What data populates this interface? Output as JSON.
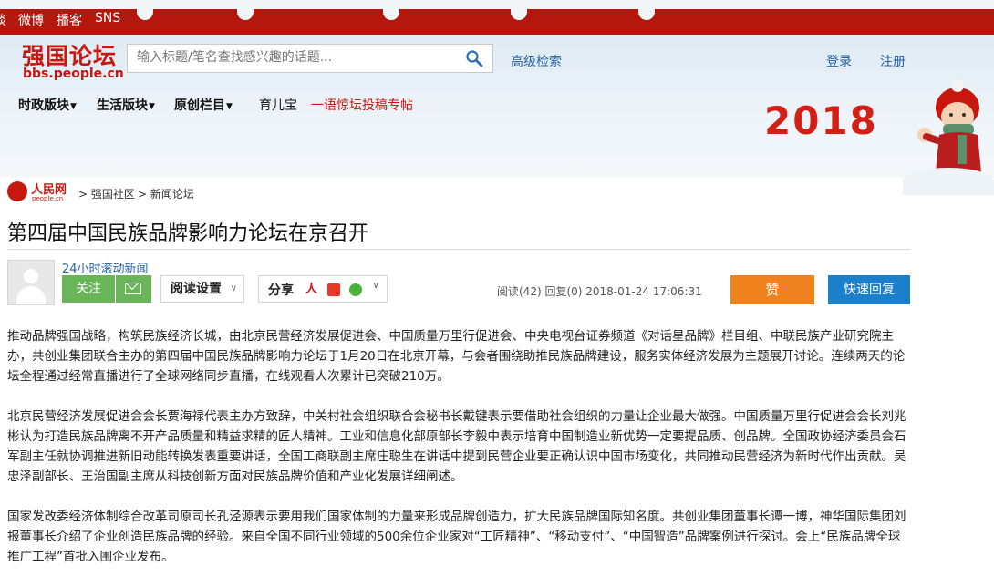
{
  "topbar": {
    "links": [
      "淡",
      "微博",
      "播客",
      "SNS"
    ]
  },
  "logo": {
    "main": "强国论坛",
    "sub": "bbs.people.cn"
  },
  "search": {
    "placeholder": "输入标题/笔名查找感兴趣的话题..."
  },
  "header": {
    "advanced_search": "高级检索",
    "login": "登录",
    "register": "注册",
    "nav": [
      "时政版块",
      "生活版块",
      "原创栏目",
      "育儿宝",
      "一语惊坛投稿专帖"
    ],
    "year": "2018"
  },
  "breadcrumb": {
    "logo_text": "人民网",
    "logo_url": "people.cn",
    "items": [
      "> 强国社区",
      "> 新闻论坛"
    ]
  },
  "article": {
    "title": "第四届中国民族品牌影响力论坛在京召开",
    "author": "24小时滚动新闻",
    "follow": "关注",
    "read_settings": "阅读设置",
    "share": "分享",
    "stats": "阅读(42) 回复(0)  2018-01-24 17:06:31",
    "like": "赞",
    "quick_reply": "快速回复",
    "paragraphs": [
      "推动品牌强国战略，构筑民族经济长城，由北京民营经济发展促进会、中国质量万里行促进会、中央电视台证券频道《对话星品牌》栏目组、中联民族产业研究院主办，共创业集团联合主办的第四届中国民族品牌影响力论坛于1月20日在北京开幕，与会者围绕助推民族品牌建设，服务实体经济发展为主题展开讨论。连续两天的论坛全程通过经常直播进行了全球网络同步直播，在线观看人次累计已突破210万。",
      "北京民营经济发展促进会会长贾海禄代表主办方致辞，中关村社会组织联合会秘书长戴键表示要借助社会组织的力量让企业最大做强。中国质量万里行促进会会长刘兆彬认为打造民族品牌离不开产品质量和精益求精的匠人精神。工业和信息化部原部长李毅中表示培育中国制造业新优势一定要提品质、创品牌。全国政协经济委员会石军副主任就协调推进新旧动能转换发表重要讲话，全国工商联副主席庄聪生在讲话中提到民营企业要正确认识中国市场变化，共同推动民营经济为新时代作出贡献。吴忠泽副部长、王治国副主席从科技创新方面对民族品牌价值和产业化发展详细阐述。",
      "国家发改委经济体制综合改革司原司长孔泾源表示要用我们国家体制的力量来形成品牌创造力，扩大民族品牌国际知名度。共创业集团董事长谭一博，神华国际集团刘报董事长介绍了企业创造民族品牌的经验。来自全国不同行业领域的500余位企业家对“工匠精神”、“移动支付”、“中国智造”品牌案例进行探讨。会上“民族品牌全球推广工程”首批入围企业发布。"
    ]
  },
  "colors": {
    "brand_red": "#c8170e",
    "link_blue": "#2263a8",
    "follow_green": "#69b659",
    "like_orange": "#f0821e",
    "reply_blue": "#1b7fcc"
  }
}
